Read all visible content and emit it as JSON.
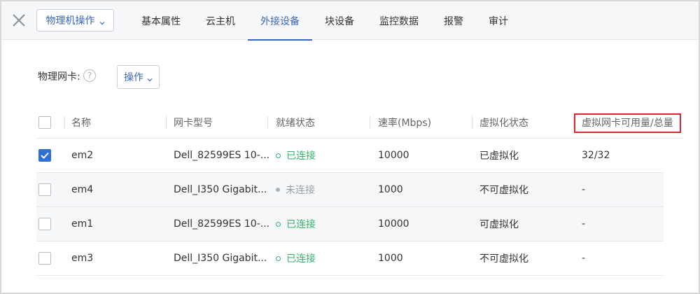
{
  "topbar": {
    "dropdown_label": "物理机操作",
    "tabs": [
      {
        "label": "基本属性"
      },
      {
        "label": "云主机"
      },
      {
        "label": "外接设备"
      },
      {
        "label": "块设备"
      },
      {
        "label": "监控数据"
      },
      {
        "label": "报警"
      },
      {
        "label": "审计"
      }
    ],
    "active_tab": "外接设备"
  },
  "section": {
    "label": "物理网卡:",
    "help": "?",
    "ops_label": "操作"
  },
  "table": {
    "columns": [
      "名称",
      "网卡型号",
      "就绪状态",
      "速率(Mbps)",
      "虚拟化状态",
      "虚拟网卡可用量/总量"
    ],
    "rows": [
      {
        "checked": true,
        "name": "em2",
        "model": "Dell_82599ES 10-...",
        "status": "已连接",
        "status_kind": "ok",
        "speed": "10000",
        "virt": "已虚拟化",
        "vnic": "32/32"
      },
      {
        "checked": false,
        "name": "em4",
        "model": "Dell_I350 Gigabit...",
        "status": "未连接",
        "status_kind": "off",
        "speed": "1000",
        "virt": "不可虚拟化",
        "vnic": "-"
      },
      {
        "checked": false,
        "name": "em1",
        "model": "Dell_82599ES 10-...",
        "status": "已连接",
        "status_kind": "ok",
        "speed": "10000",
        "virt": "可虚拟化",
        "vnic": "-"
      },
      {
        "checked": false,
        "name": "em3",
        "model": "Dell_I350 Gigabit...",
        "status": "已连接",
        "status_kind": "ok",
        "speed": "1000",
        "virt": "不可虚拟化",
        "vnic": "-"
      }
    ]
  },
  "colors": {
    "accent": "#3b67b8",
    "status_ok": "#36b36b",
    "status_off": "#9aa0aa",
    "highlight": "#d7262e"
  },
  "icons": {
    "close": "close-icon",
    "caret": "chevron-down-icon",
    "help": "help-icon",
    "check": "check-icon"
  }
}
